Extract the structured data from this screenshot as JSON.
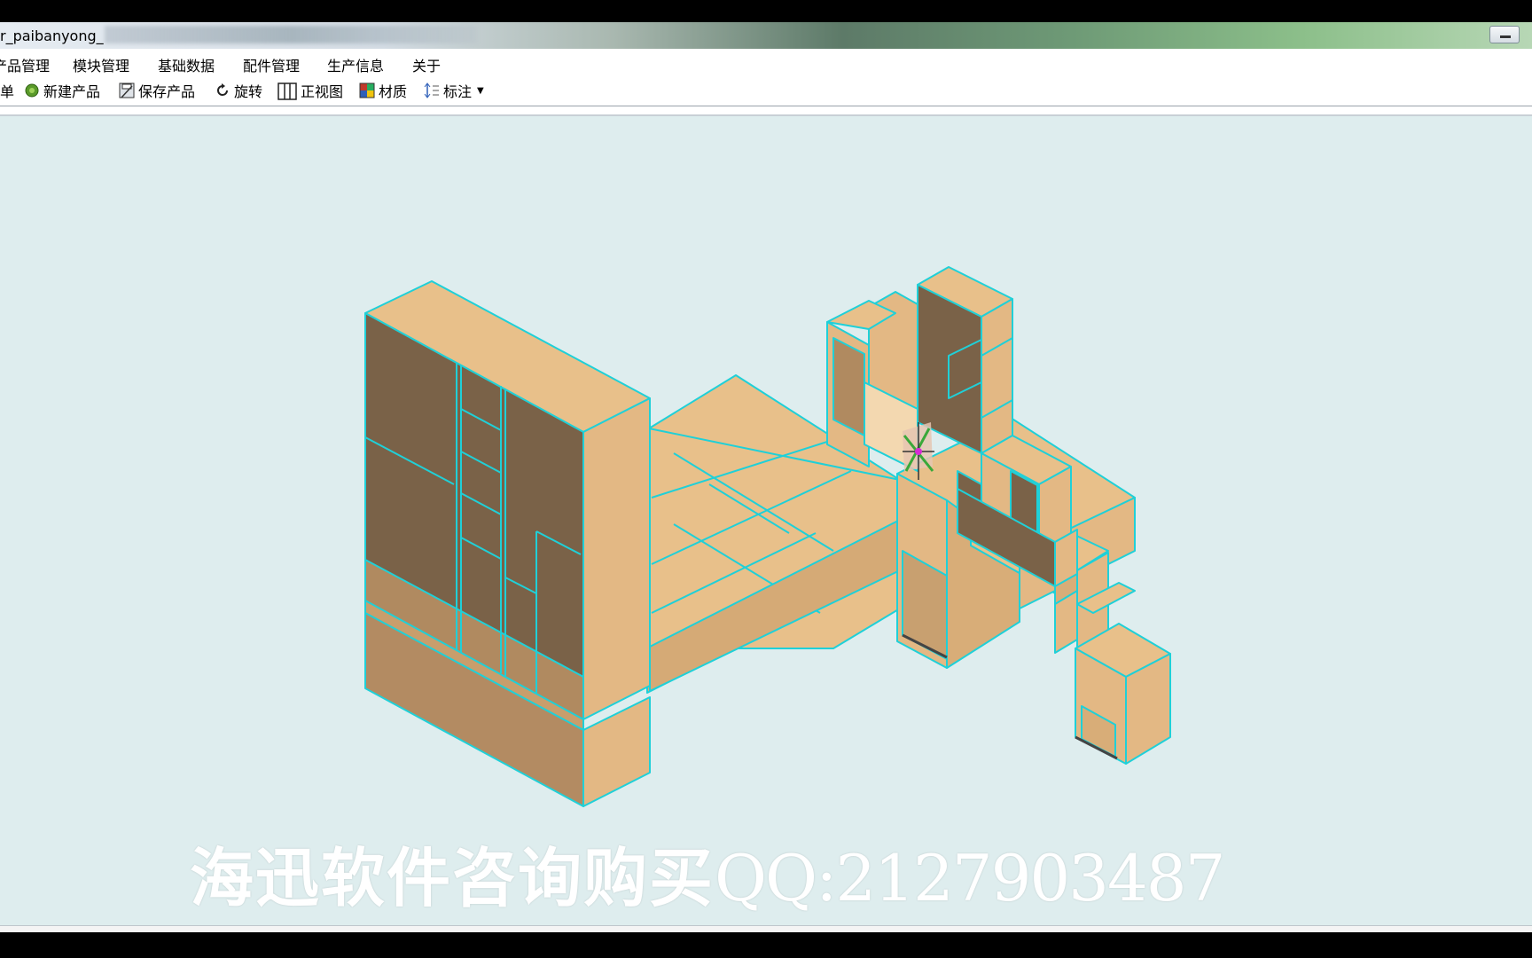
{
  "window": {
    "title": "r_paibanyong_"
  },
  "menu": {
    "items": [
      "产品管理",
      "模块管理",
      "基础数据",
      "配件管理",
      "生产信息",
      "关于"
    ]
  },
  "toolbar": {
    "items": [
      {
        "label": "单",
        "icon": "list-icon"
      },
      {
        "label": "新建产品",
        "icon": "new-product-icon"
      },
      {
        "label": "保存产品",
        "icon": "save-icon"
      },
      {
        "label": "旋转",
        "icon": "rotate-icon"
      },
      {
        "label": "正视图",
        "icon": "front-view-icon"
      },
      {
        "label": "材质",
        "icon": "material-icon"
      },
      {
        "label": "标注",
        "icon": "dimension-icon"
      }
    ]
  },
  "watermark": {
    "text_cn": "海迅软件咨询购买",
    "text_qq": "QQ:2127903487"
  },
  "colors": {
    "viewport_bg": "#deedee",
    "panel_light": "#e8c08a",
    "panel_dark": "#7a6248",
    "edge": "#1fd0d8"
  }
}
